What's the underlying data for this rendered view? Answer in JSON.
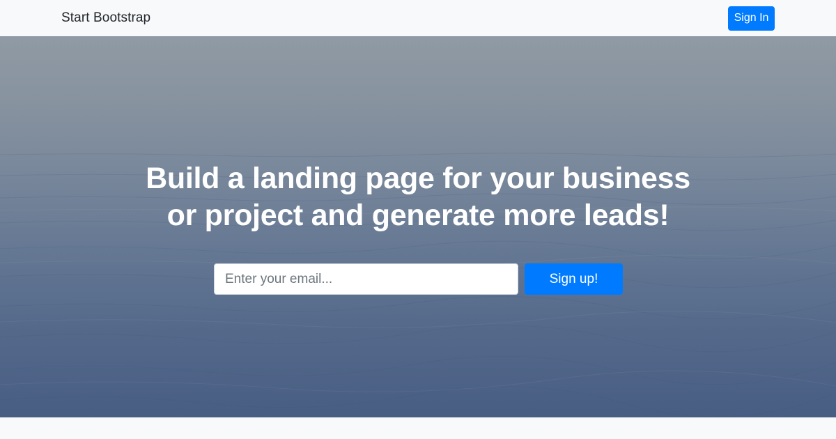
{
  "navbar": {
    "brand": "Start Bootstrap",
    "signin_label": "Sign In"
  },
  "hero": {
    "headline_line1": "Build a landing page for your business",
    "headline_line2": "or project and generate more leads!",
    "email_placeholder": "Enter your email...",
    "email_value": "",
    "signup_label": "Sign up!",
    "background": "misty-ocean-photo"
  },
  "colors": {
    "primary": "#007bff",
    "navbar_bg": "#f8f9fa",
    "headline": "#ffffff"
  }
}
